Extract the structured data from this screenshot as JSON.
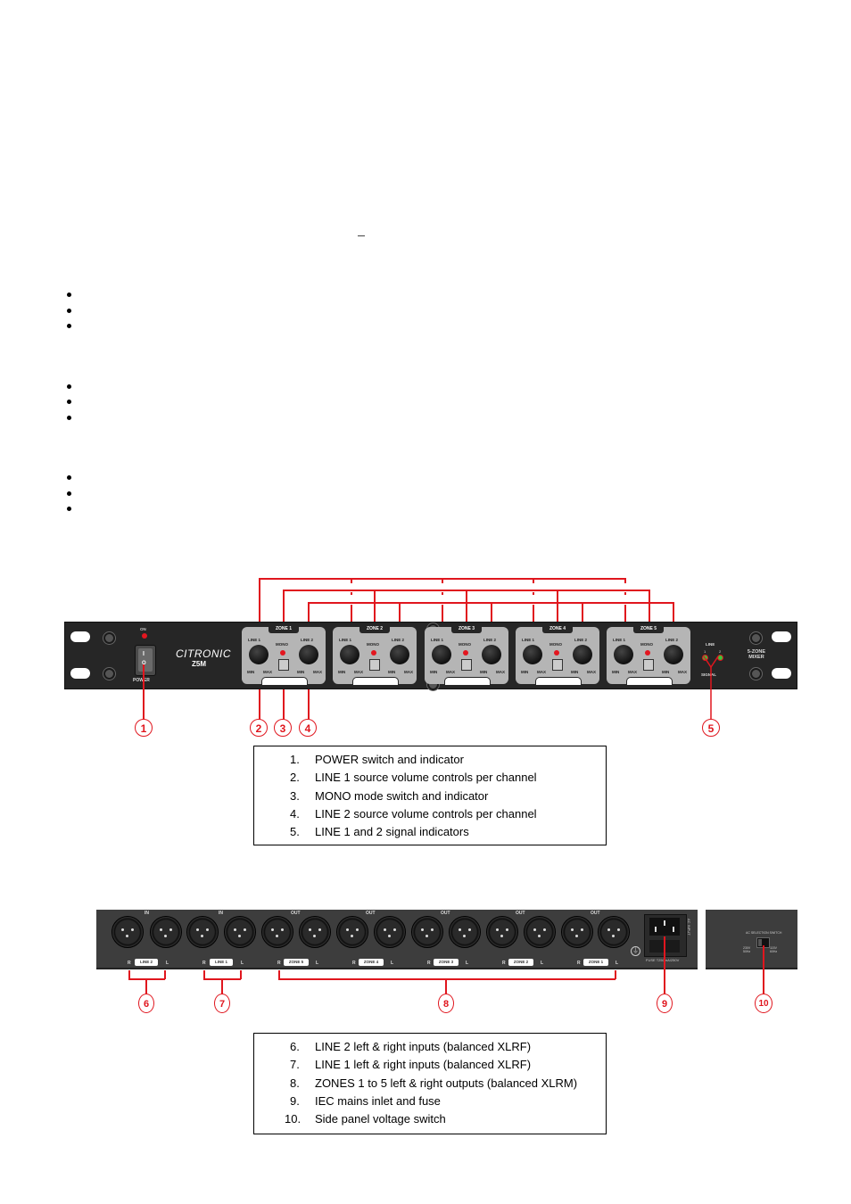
{
  "page": {
    "dash": "–",
    "bullet_groups": [
      {
        "items": [
          "",
          "",
          ""
        ]
      },
      {
        "items": [
          "",
          "",
          ""
        ]
      },
      {
        "items": [
          "",
          "",
          ""
        ]
      }
    ]
  },
  "front_panel": {
    "power_indicator_label": "ON",
    "power_label": "POWER",
    "switch_on_symbol": "I",
    "switch_off_symbol": "O",
    "brand": "CITRONIC",
    "model": "Z5M",
    "zones": [
      {
        "tag": "ZONE 1",
        "line1": "LINE 1",
        "line2": "LINE 2",
        "mono": "MONO",
        "min": "MIN",
        "max": "MAX"
      },
      {
        "tag": "ZONE 2",
        "line1": "LINE 1",
        "line2": "LINE 2",
        "mono": "MONO",
        "min": "MIN",
        "max": "MAX"
      },
      {
        "tag": "ZONE 3",
        "line1": "LINE 1",
        "line2": "LINE 2",
        "mono": "MONO",
        "min": "MIN",
        "max": "MAX"
      },
      {
        "tag": "ZONE 4",
        "line1": "LINE 1",
        "line2": "LINE 2",
        "mono": "MONO",
        "min": "MIN",
        "max": "MAX"
      },
      {
        "tag": "ZONE 5",
        "line1": "LINE 1",
        "line2": "LINE 2",
        "mono": "MONO",
        "min": "MIN",
        "max": "MAX"
      }
    ],
    "signal": {
      "top_label": "LINE",
      "left": "1",
      "right": "2",
      "bottom_label": "SIGNAL"
    },
    "mixer_label_line1": "5-ZONE",
    "mixer_label_line2": "MIXER",
    "callouts": [
      "1",
      "2",
      "3",
      "4",
      "5"
    ]
  },
  "front_legend": [
    {
      "num": "1.",
      "text": "POWER switch and indicator"
    },
    {
      "num": "2.",
      "text": "LINE 1 source volume controls per channel"
    },
    {
      "num": "3.",
      "text": "MONO mode switch and indicator"
    },
    {
      "num": "4.",
      "text": "LINE 2 source volume controls per channel"
    },
    {
      "num": "5.",
      "text": "LINE 1 and 2 signal indicators"
    }
  ],
  "rear_panel": {
    "in_label": "IN",
    "out_label": "OUT",
    "r": "R",
    "l": "L",
    "groups": [
      {
        "header": "IN",
        "tag": "LINE 2"
      },
      {
        "header": "IN",
        "tag": "LINE 1"
      },
      {
        "header": "OUT",
        "tag": "ZONE 5"
      },
      {
        "header": "OUT",
        "tag": "ZONE 4"
      },
      {
        "header": "OUT",
        "tag": "ZONE 3"
      },
      {
        "header": "OUT",
        "tag": "ZONE 2"
      },
      {
        "header": "OUT",
        "tag": "ZONE 1"
      }
    ],
    "ac_input_label": "AC INPUT",
    "fuse_label": "FUSE T250mA/250V",
    "ac_selection_label": "AC SELECTION SWITCH",
    "volt_left": "230V 50Hz",
    "volt_right": "115V 60Hz",
    "callouts": [
      "6",
      "7",
      "8",
      "9",
      "10"
    ]
  },
  "rear_legend": [
    {
      "num": "6.",
      "text": "LINE 2 left & right inputs (balanced XLRF)"
    },
    {
      "num": "7.",
      "text": "LINE 1 left & right inputs (balanced XLRF)"
    },
    {
      "num": "8.",
      "text": "ZONES 1 to 5 left & right outputs (balanced XLRM)"
    },
    {
      "num": "9.",
      "text": "IEC mains inlet and fuse"
    },
    {
      "num": "10.",
      "text": "Side panel voltage switch"
    }
  ]
}
